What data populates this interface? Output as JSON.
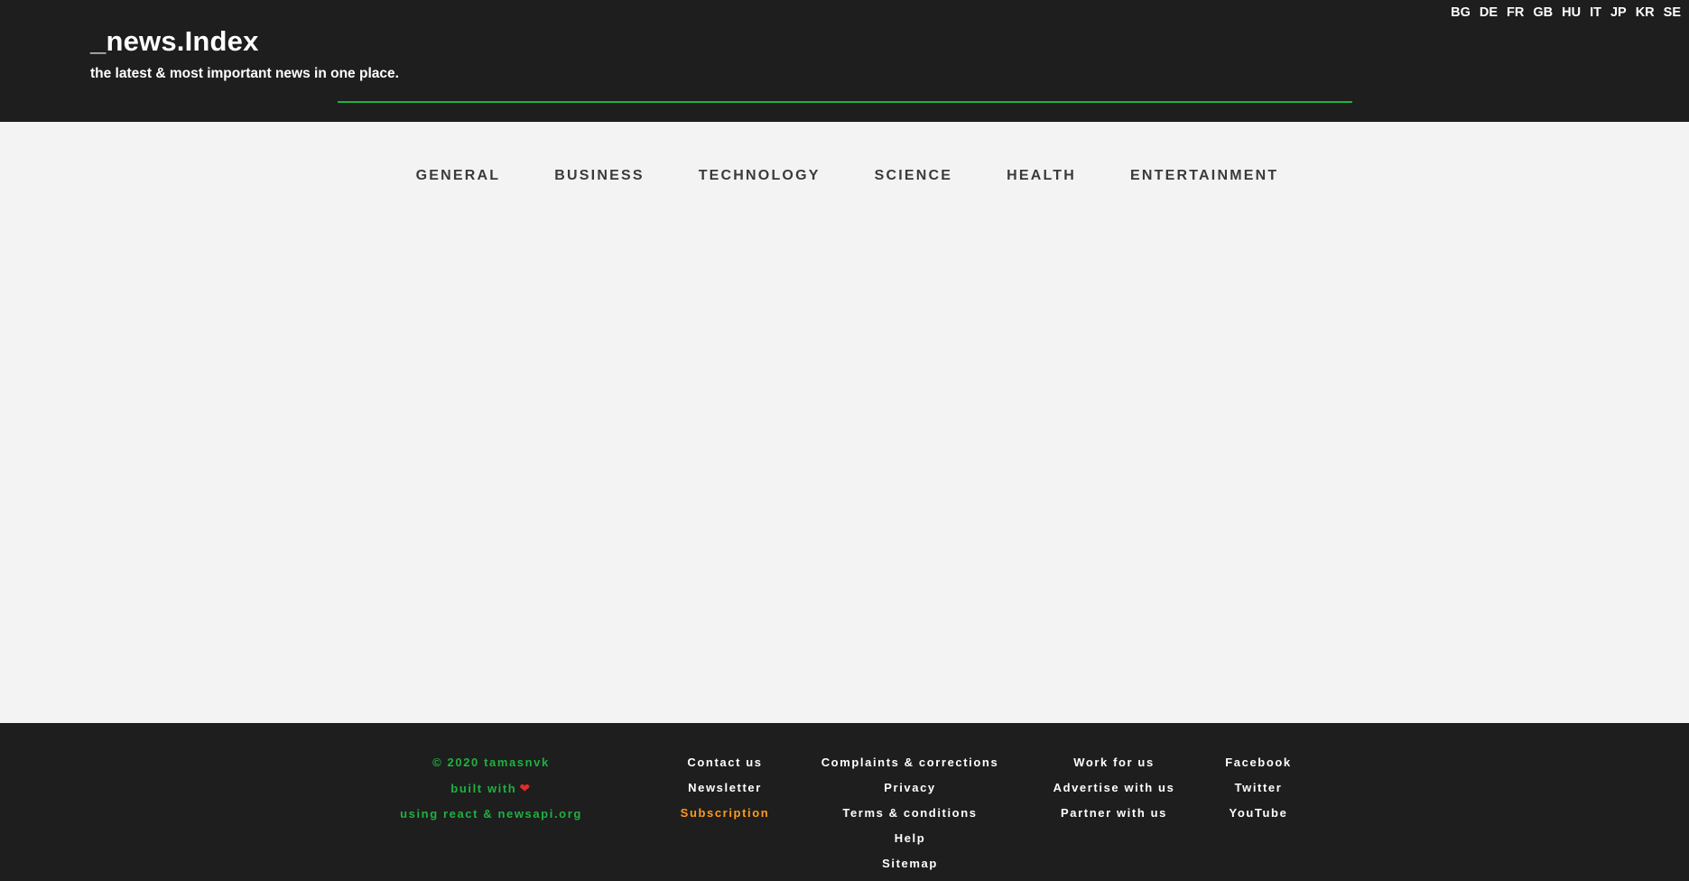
{
  "header": {
    "title": "_news.Index",
    "tagline": "the latest & most important news in one place.",
    "accent_color": "#1fb141",
    "countries": [
      "BG",
      "DE",
      "FR",
      "GB",
      "HU",
      "IT",
      "JP",
      "KR",
      "SE"
    ]
  },
  "nav": {
    "categories": [
      "GENERAL",
      "BUSINESS",
      "TECHNOLOGY",
      "SCIENCE",
      "HEALTH",
      "ENTERTAINMENT"
    ]
  },
  "footer": {
    "credits": {
      "copyright": "© 2020 tamasnvk",
      "built_with": "built with",
      "heart_icon": "heart-icon",
      "using": "using react & newsapi.org",
      "color": "#1fb141"
    },
    "col1": [
      "Contact us",
      "Newsletter",
      "Subscription"
    ],
    "col1_highlight_color": "#ff9a1f",
    "col2": [
      "Complaints & corrections",
      "Privacy",
      "Terms & conditions",
      "Help",
      "Sitemap"
    ],
    "col3": [
      "Work for us",
      "Advertise with us",
      "Partner with us"
    ],
    "col4": [
      "Facebook",
      "Twitter",
      "YouTube"
    ]
  }
}
